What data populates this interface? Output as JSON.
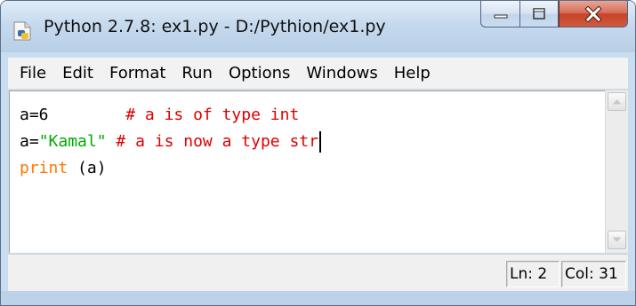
{
  "window": {
    "title": "Python 2.7.8: ex1.py - D:/Pythion/ex1.py",
    "icon": "python-file-icon",
    "controls": [
      "minimize-icon",
      "maximize-icon",
      "close-icon"
    ]
  },
  "menu": {
    "items": [
      {
        "label": "File"
      },
      {
        "label": "Edit"
      },
      {
        "label": "Format"
      },
      {
        "label": "Run"
      },
      {
        "label": "Options"
      },
      {
        "label": "Windows"
      },
      {
        "label": "Help"
      }
    ]
  },
  "editor": {
    "lines": [
      {
        "code": "a=6",
        "pad": "        ",
        "comment": "# a is of type int"
      },
      {
        "lhs": "a=",
        "string": "\"Kamal\"",
        "space": " ",
        "comment": "# a is now a type str"
      },
      {
        "keyword": "print",
        "rest": " (a)"
      }
    ],
    "colors": {
      "comment": "#dd0000",
      "string": "#00aa00",
      "keyword": "#ff7700",
      "default": "#000000"
    }
  },
  "status": {
    "line": "Ln: 2",
    "column": "Col: 31"
  }
}
